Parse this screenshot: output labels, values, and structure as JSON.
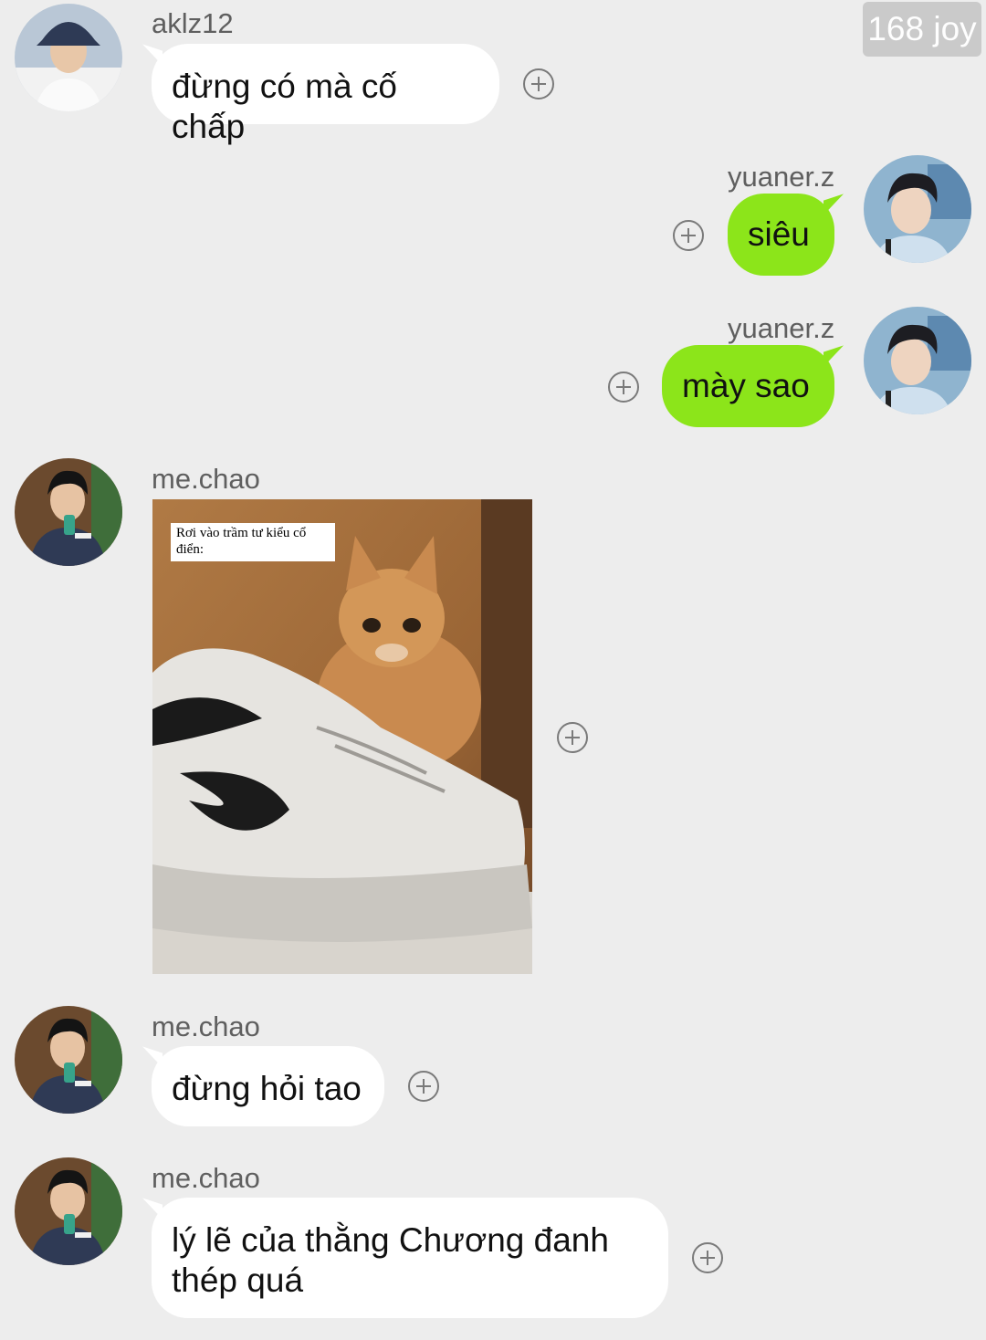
{
  "watermark": "168 joy",
  "messages": [
    {
      "sender": "aklz12",
      "text": "đừng có mà cố chấp"
    },
    {
      "sender": "yuaner.z",
      "text": "siêu"
    },
    {
      "sender": "yuaner.z",
      "text": "mày sao"
    },
    {
      "sender": "me.chao",
      "image_caption": "Rơi vào trầm tư kiểu cổ điển:"
    },
    {
      "sender": "me.chao",
      "text": "đừng hỏi tao"
    },
    {
      "sender": "me.chao",
      "text_lines": [
        "lý lẽ của thằng Chương đanh",
        "thép quá"
      ]
    }
  ],
  "colors": {
    "background": "#ededed",
    "outgoing_bubble": "#8ce51a",
    "incoming_bubble": "#ffffff"
  },
  "icons": {
    "add_reaction": "plus-circle-icon"
  }
}
